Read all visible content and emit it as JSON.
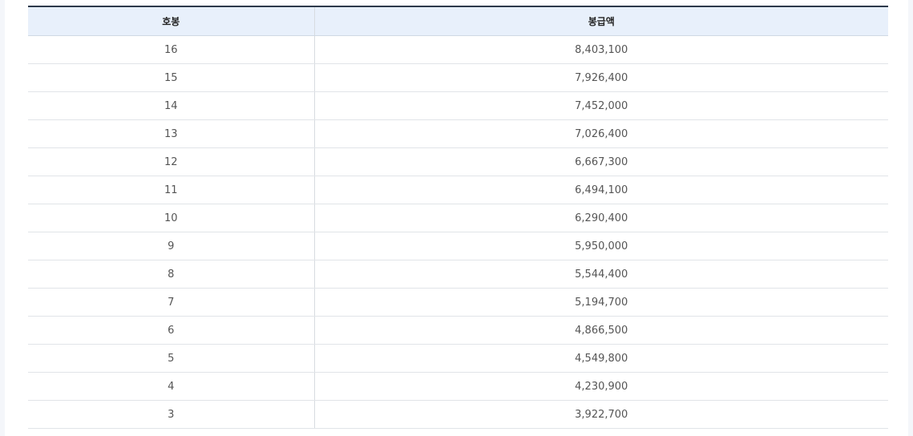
{
  "table": {
    "headers": {
      "step": "호봉",
      "salary": "봉급액"
    },
    "rows": [
      {
        "step": "16",
        "salary": "8,403,100"
      },
      {
        "step": "15",
        "salary": "7,926,400"
      },
      {
        "step": "14",
        "salary": "7,452,000"
      },
      {
        "step": "13",
        "salary": "7,026,400"
      },
      {
        "step": "12",
        "salary": "6,667,300"
      },
      {
        "step": "11",
        "salary": "6,494,100"
      },
      {
        "step": "10",
        "salary": "6,290,400"
      },
      {
        "step": "9",
        "salary": "5,950,000"
      },
      {
        "step": "8",
        "salary": "5,544,400"
      },
      {
        "step": "7",
        "salary": "5,194,700"
      },
      {
        "step": "6",
        "salary": "4,866,500"
      },
      {
        "step": "5",
        "salary": "4,549,800"
      },
      {
        "step": "4",
        "salary": "4,230,900"
      },
      {
        "step": "3",
        "salary": "3,922,700"
      }
    ]
  }
}
